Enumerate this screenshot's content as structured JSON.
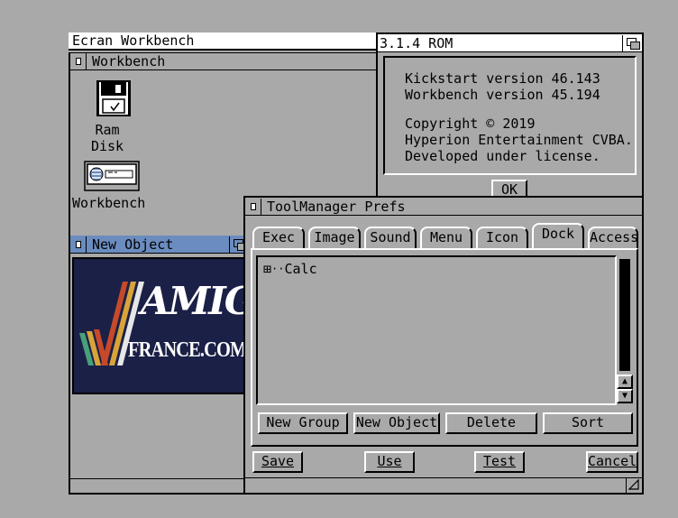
{
  "screen": {
    "title": "Ecran Workbench"
  },
  "workbench_window": {
    "title": "Workbench"
  },
  "icons": [
    {
      "label": "Ram Disk",
      "icon": "floppy-disk-icon"
    },
    {
      "label": "Workbench",
      "icon": "hard-drive-icon"
    }
  ],
  "new_object_window": {
    "title": "New Object",
    "banner": {
      "line1": "AMIGA",
      "line2": "FRANCE.COM"
    }
  },
  "about_window": {
    "title": "3.1.4 ROM",
    "lines": [
      "Kickstart version 46.143",
      "Workbench version 45.194",
      "",
      "Copyright © 2019",
      "Hyperion Entertainment CVBA.",
      "Developed under license."
    ],
    "ok_label": "OK"
  },
  "toolmanager": {
    "title": "ToolManager Prefs",
    "tabs": [
      "Exec",
      "Image",
      "Sound",
      "Menu",
      "Icon",
      "Dock",
      "Access"
    ],
    "active_tab": "Dock",
    "tree_items": [
      {
        "label": "Calc",
        "expander": "⊞"
      }
    ],
    "actions": [
      "New Group",
      "New Object",
      "Delete",
      "Sort"
    ],
    "bottom_buttons": [
      "Save",
      "Use",
      "Test",
      "Cancel"
    ],
    "scroll_up": "▲",
    "scroll_down": "▼"
  },
  "colors": {
    "background": "#a9a9a9",
    "active_title": "#6b8cbf",
    "banner_bg": "#1b2047"
  }
}
